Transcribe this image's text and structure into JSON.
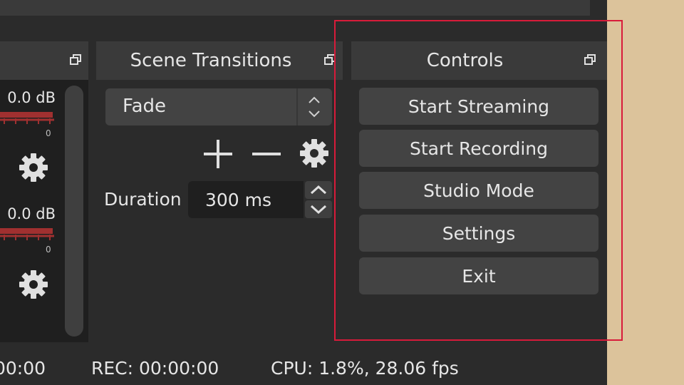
{
  "panels": {
    "scene_transitions": {
      "title": "Scene Transitions"
    },
    "controls": {
      "title": "Controls"
    }
  },
  "mixer": {
    "channels": [
      {
        "level": "0.0 dB",
        "zero_label": "0"
      },
      {
        "level": "0.0 dB",
        "zero_label": "0"
      }
    ]
  },
  "transitions": {
    "selected": "Fade",
    "duration_label": "Duration",
    "duration_value": "300 ms"
  },
  "controls": {
    "buttons": [
      "Start Streaming",
      "Start Recording",
      "Studio Mode",
      "Settings",
      "Exit"
    ]
  },
  "status_bar": {
    "live_time": "00:00",
    "rec": "REC: 00:00:00",
    "cpu": "CPU: 1.8%, 28.06 fps"
  },
  "colors": {
    "highlight": "#d81b3a",
    "meter": "#a03030",
    "panel": "#3a3a3a",
    "background": "#2b2b2b",
    "desktop": "#dcc39b"
  },
  "icons": [
    "float-icon",
    "gear-icon",
    "plus-icon",
    "minus-icon",
    "chevron-up-icon",
    "chevron-down-icon"
  ]
}
